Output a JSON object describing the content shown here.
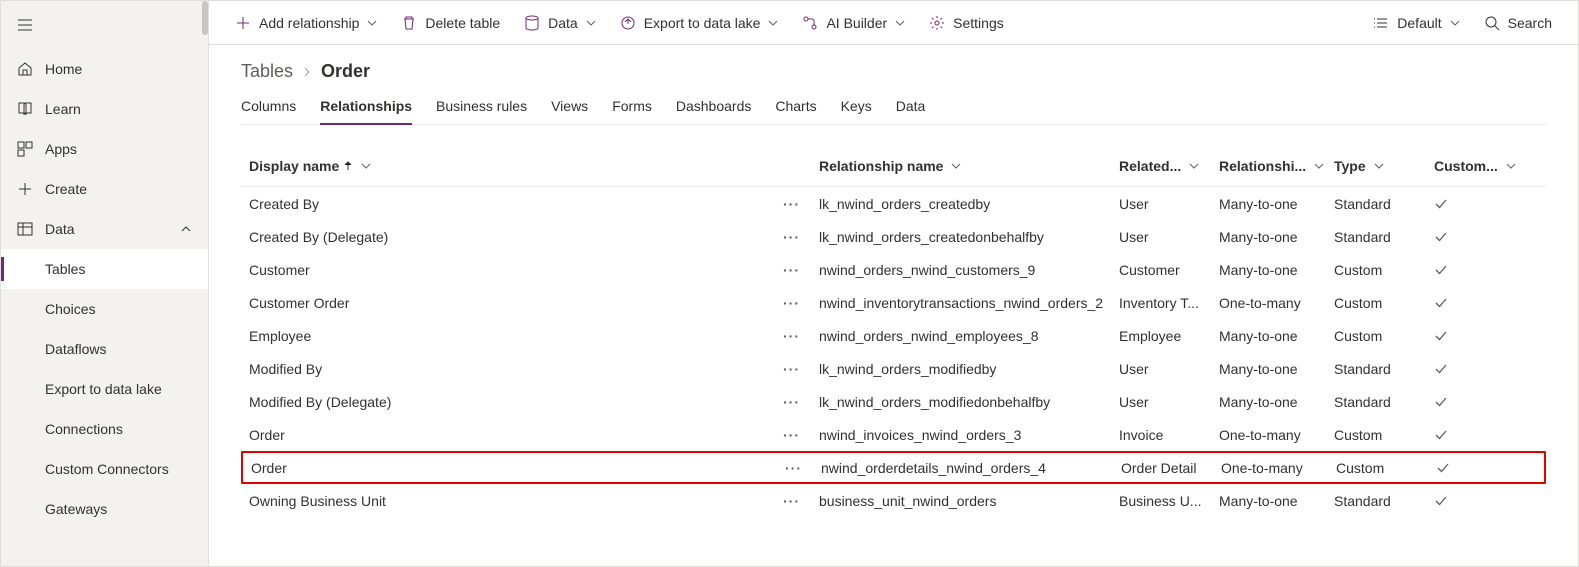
{
  "sidebar": {
    "items": [
      {
        "label": "Home"
      },
      {
        "label": "Learn"
      },
      {
        "label": "Apps"
      },
      {
        "label": "Create"
      },
      {
        "label": "Data"
      }
    ],
    "data_children": [
      {
        "label": "Tables"
      },
      {
        "label": "Choices"
      },
      {
        "label": "Dataflows"
      },
      {
        "label": "Export to data lake"
      },
      {
        "label": "Connections"
      },
      {
        "label": "Custom Connectors"
      },
      {
        "label": "Gateways"
      }
    ]
  },
  "commandbar": {
    "add_relationship": "Add relationship",
    "delete_table": "Delete table",
    "data": "Data",
    "export": "Export to data lake",
    "ai_builder": "AI Builder",
    "settings": "Settings",
    "default": "Default",
    "search": "Search"
  },
  "breadcrumb": {
    "parent": "Tables",
    "current": "Order"
  },
  "tabs": [
    {
      "label": "Columns"
    },
    {
      "label": "Relationships"
    },
    {
      "label": "Business rules"
    },
    {
      "label": "Views"
    },
    {
      "label": "Forms"
    },
    {
      "label": "Dashboards"
    },
    {
      "label": "Charts"
    },
    {
      "label": "Keys"
    },
    {
      "label": "Data"
    }
  ],
  "columns": {
    "display_name": "Display name",
    "relationship_name": "Relationship name",
    "related": "Related...",
    "relationship_type_short": "Relationshi...",
    "type": "Type",
    "custom": "Custom..."
  },
  "rows": [
    {
      "display": "Created By",
      "relname": "lk_nwind_orders_createdby",
      "related": "User",
      "reltype": "Many-to-one",
      "type": "Standard"
    },
    {
      "display": "Created By (Delegate)",
      "relname": "lk_nwind_orders_createdonbehalfby",
      "related": "User",
      "reltype": "Many-to-one",
      "type": "Standard"
    },
    {
      "display": "Customer",
      "relname": "nwind_orders_nwind_customers_9",
      "related": "Customer",
      "reltype": "Many-to-one",
      "type": "Custom"
    },
    {
      "display": "Customer Order",
      "relname": "nwind_inventorytransactions_nwind_orders_2",
      "related": "Inventory T...",
      "reltype": "One-to-many",
      "type": "Custom"
    },
    {
      "display": "Employee",
      "relname": "nwind_orders_nwind_employees_8",
      "related": "Employee",
      "reltype": "Many-to-one",
      "type": "Custom"
    },
    {
      "display": "Modified By",
      "relname": "lk_nwind_orders_modifiedby",
      "related": "User",
      "reltype": "Many-to-one",
      "type": "Standard"
    },
    {
      "display": "Modified By (Delegate)",
      "relname": "lk_nwind_orders_modifiedonbehalfby",
      "related": "User",
      "reltype": "Many-to-one",
      "type": "Standard"
    },
    {
      "display": "Order",
      "relname": "nwind_invoices_nwind_orders_3",
      "related": "Invoice",
      "reltype": "One-to-many",
      "type": "Custom"
    },
    {
      "display": "Order",
      "relname": "nwind_orderdetails_nwind_orders_4",
      "related": "Order Detail",
      "reltype": "One-to-many",
      "type": "Custom",
      "highlight": true
    },
    {
      "display": "Owning Business Unit",
      "relname": "business_unit_nwind_orders",
      "related": "Business U...",
      "reltype": "Many-to-one",
      "type": "Standard"
    }
  ]
}
